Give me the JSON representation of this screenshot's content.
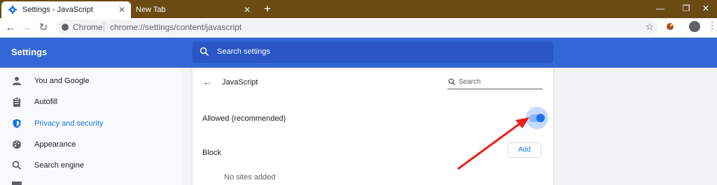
{
  "window": {
    "tabs": [
      {
        "label": "Settings - JavaScript",
        "close": "✕"
      },
      {
        "label": "New Tab",
        "close": "✕"
      }
    ],
    "new_tab": "+",
    "controls": {
      "minimize": "—",
      "restore": "❐",
      "close": "✕"
    }
  },
  "toolbar": {
    "back": "←",
    "forward": "→",
    "reload": "↻",
    "chip": "Chrome",
    "url": "chrome://settings/content/javascript",
    "star": "☆",
    "menu": "⋮"
  },
  "header": {
    "title": "Settings",
    "search_placeholder": "Search settings"
  },
  "sidebar": {
    "items": [
      {
        "label": "You and Google",
        "icon": "person-icon"
      },
      {
        "label": "Autofill",
        "icon": "clipboard-icon"
      },
      {
        "label": "Privacy and security",
        "icon": "shield-icon",
        "active": true
      },
      {
        "label": "Appearance",
        "icon": "palette-icon"
      },
      {
        "label": "Search engine",
        "icon": "search-icon"
      }
    ]
  },
  "main": {
    "back": "←",
    "title": "JavaScript",
    "search_placeholder": "Search",
    "allowed_label": "Allowed (recommended)",
    "allowed_on": true,
    "block_label": "Block",
    "add_label": "Add",
    "no_sites": "No sites added"
  },
  "colors": {
    "accent": "#1a73e8",
    "header": "#3367d6",
    "annotation_arrow": "#e8211c"
  }
}
